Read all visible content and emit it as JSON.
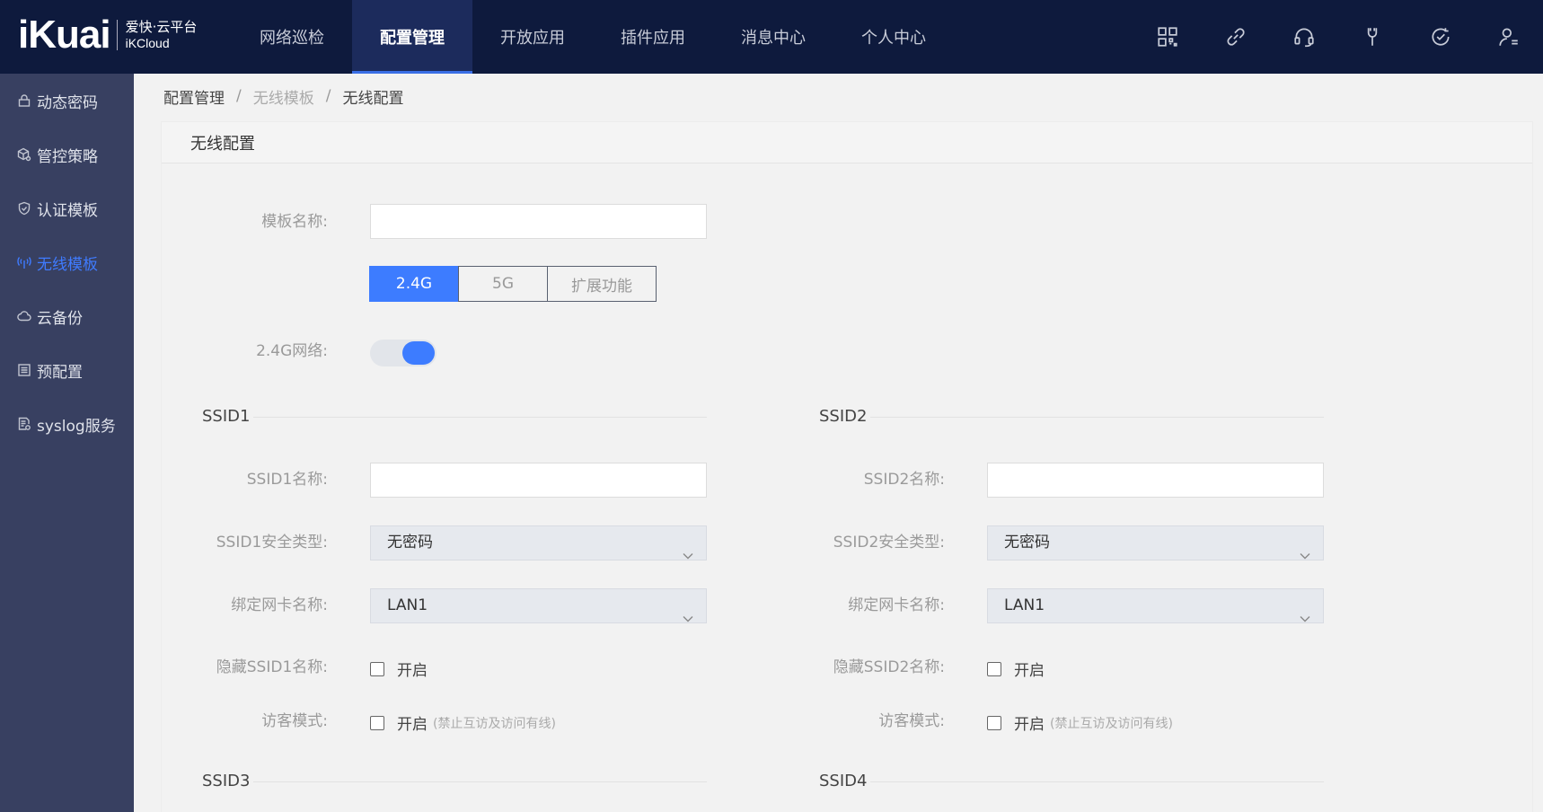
{
  "logo": {
    "main": "iKuai",
    "cn": "爱快·云平台",
    "en": "iKCloud"
  },
  "nav": {
    "items": [
      {
        "label": "网络巡检"
      },
      {
        "label": "配置管理"
      },
      {
        "label": "开放应用"
      },
      {
        "label": "插件应用"
      },
      {
        "label": "消息中心"
      },
      {
        "label": "个人中心"
      }
    ],
    "active": "配置管理"
  },
  "top_icons": [
    "grid-icon",
    "link-icon",
    "headset-icon",
    "wrench-icon",
    "refresh-check-icon",
    "user-icon"
  ],
  "sidebar": {
    "items": [
      {
        "label": "动态密码",
        "icon": "lock-icon"
      },
      {
        "label": "管控策略",
        "icon": "cube-gear-icon"
      },
      {
        "label": "认证模板",
        "icon": "shield-icon"
      },
      {
        "label": "无线模板",
        "icon": "wifi-icon"
      },
      {
        "label": "云备份",
        "icon": "cloud-icon"
      },
      {
        "label": "预配置",
        "icon": "list-icon"
      },
      {
        "label": "syslog服务",
        "icon": "document-gear-icon"
      }
    ],
    "active": "无线模板"
  },
  "breadcrumb": {
    "items": [
      "配置管理",
      "无线模板",
      "无线配置"
    ],
    "sep": "/"
  },
  "panel": {
    "title": "无线配置"
  },
  "form": {
    "template_name_label": "模板名称:",
    "template_name_value": "",
    "tabs": [
      "2.4G",
      "5G",
      "扩展功能"
    ],
    "active_tab": "2.4G",
    "network_label": "2.4G网络:",
    "network_enabled": true
  },
  "ssid_groups": [
    {
      "title": "SSID1",
      "name_label": "SSID1名称:",
      "name_value": "",
      "security_label": "SSID1安全类型:",
      "security_value": "无密码",
      "nic_label": "绑定网卡名称:",
      "nic_value": "LAN1",
      "hide_label": "隐藏SSID1名称:",
      "hide_option": "开启",
      "guest_label": "访客模式:",
      "guest_option": "开启",
      "guest_note": "(禁止互访及访问有线)"
    },
    {
      "title": "SSID2",
      "name_label": "SSID2名称:",
      "name_value": "",
      "security_label": "SSID2安全类型:",
      "security_value": "无密码",
      "nic_label": "绑定网卡名称:",
      "nic_value": "LAN1",
      "hide_label": "隐藏SSID2名称:",
      "hide_option": "开启",
      "guest_label": "访客模式:",
      "guest_option": "开启",
      "guest_note": "(禁止互访及访问有线)"
    }
  ],
  "next_sections": [
    "SSID3",
    "SSID4"
  ],
  "colors": {
    "topbar": "#0e1a3d",
    "sidebar": "#384061",
    "accent": "#3d7cff"
  }
}
